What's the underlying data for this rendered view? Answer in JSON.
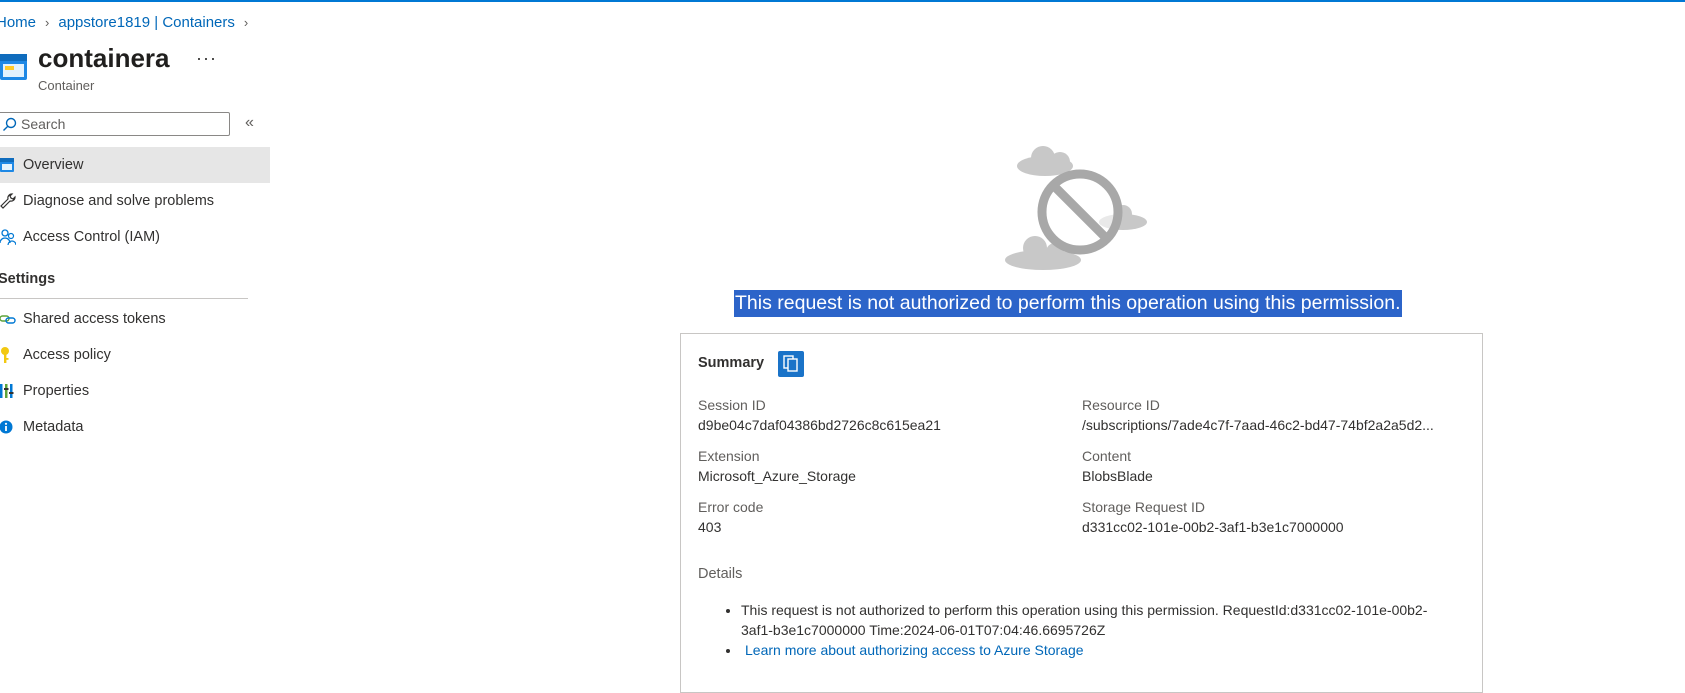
{
  "breadcrumb": {
    "home": "Home",
    "parent": "appstore1819 | Containers"
  },
  "header": {
    "title": "containera",
    "subtitle": "Container",
    "more": "···"
  },
  "search": {
    "placeholder": "Search",
    "value": ""
  },
  "collapse_glyph": "«",
  "nav": {
    "items": [
      {
        "label": "Overview",
        "icon": "container-icon",
        "active": true
      },
      {
        "label": "Diagnose and solve problems",
        "icon": "wrench-icon"
      },
      {
        "label": "Access Control (IAM)",
        "icon": "people-icon"
      }
    ],
    "settings_header": "Settings",
    "settings_items": [
      {
        "label": "Shared access tokens",
        "icon": "link-icon"
      },
      {
        "label": "Access policy",
        "icon": "key-icon"
      },
      {
        "label": "Properties",
        "icon": "properties-icon"
      },
      {
        "label": "Metadata",
        "icon": "info-icon"
      }
    ]
  },
  "error": {
    "message": "This request is not authorized to perform this operation using this permission.",
    "summary": {
      "heading": "Summary",
      "fields": [
        {
          "label": "Session ID",
          "value": "d9be04c7daf04386bd2726c8c615ea21"
        },
        {
          "label": "Resource ID",
          "value": "/subscriptions/7ade4c7f-7aad-46c2-bd47-74bf2a2a5d2..."
        },
        {
          "label": "Extension",
          "value": "Microsoft_Azure_Storage"
        },
        {
          "label": "Content",
          "value": "BlobsBlade"
        },
        {
          "label": "Error code",
          "value": "403"
        },
        {
          "label": "Storage Request ID",
          "value": "d331cc02-101e-00b2-3af1-b3e1c7000000"
        }
      ],
      "details_label": "Details",
      "detail_text": "This request is not authorized to perform this operation using this permission. RequestId:d331cc02-101e-00b2-3af1-b3e1c7000000 Time:2024-06-01T07:04:46.6695726Z",
      "learn_more": "Learn more about authorizing access to Azure Storage"
    }
  },
  "colors": {
    "accent": "#0078d4",
    "link": "#0067b8",
    "selection": "#2c64c9",
    "nav_active": "#e6e6e6"
  }
}
